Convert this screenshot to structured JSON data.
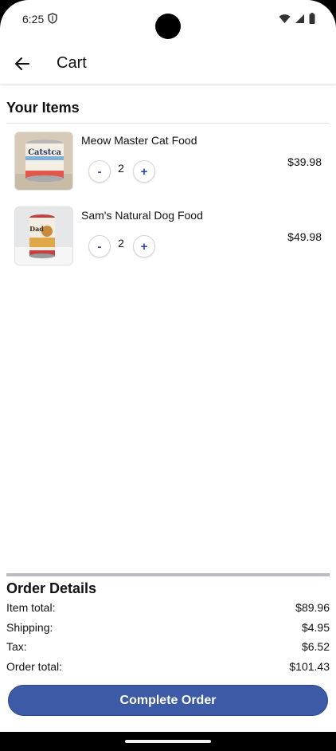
{
  "status_bar": {
    "time": "6:25"
  },
  "app_bar": {
    "title": "Cart",
    "back_icon": "arrow-left-icon"
  },
  "items_section": {
    "title": "Your Items",
    "items": [
      {
        "name": "Meow Master Cat Food",
        "quantity": "2",
        "price": "$39.98",
        "minus_label": "-",
        "plus_label": "+",
        "image_text": "Catstca"
      },
      {
        "name": "Sam's Natural Dog Food",
        "quantity": "2",
        "price": "$49.98",
        "minus_label": "-",
        "plus_label": "+",
        "image_text": "Dad"
      }
    ]
  },
  "order_details": {
    "title": "Order Details",
    "rows": [
      {
        "label": "Item total:",
        "value": "$89.96"
      },
      {
        "label": "Shipping:",
        "value": "$4.95"
      },
      {
        "label": "Tax:",
        "value": "$6.52"
      },
      {
        "label": "Order total:",
        "value": "$101.43"
      }
    ]
  },
  "actions": {
    "complete_label": "Complete Order"
  },
  "colors": {
    "accent": "#3d5aa6",
    "qty_button_text": "#2a4aa8"
  }
}
